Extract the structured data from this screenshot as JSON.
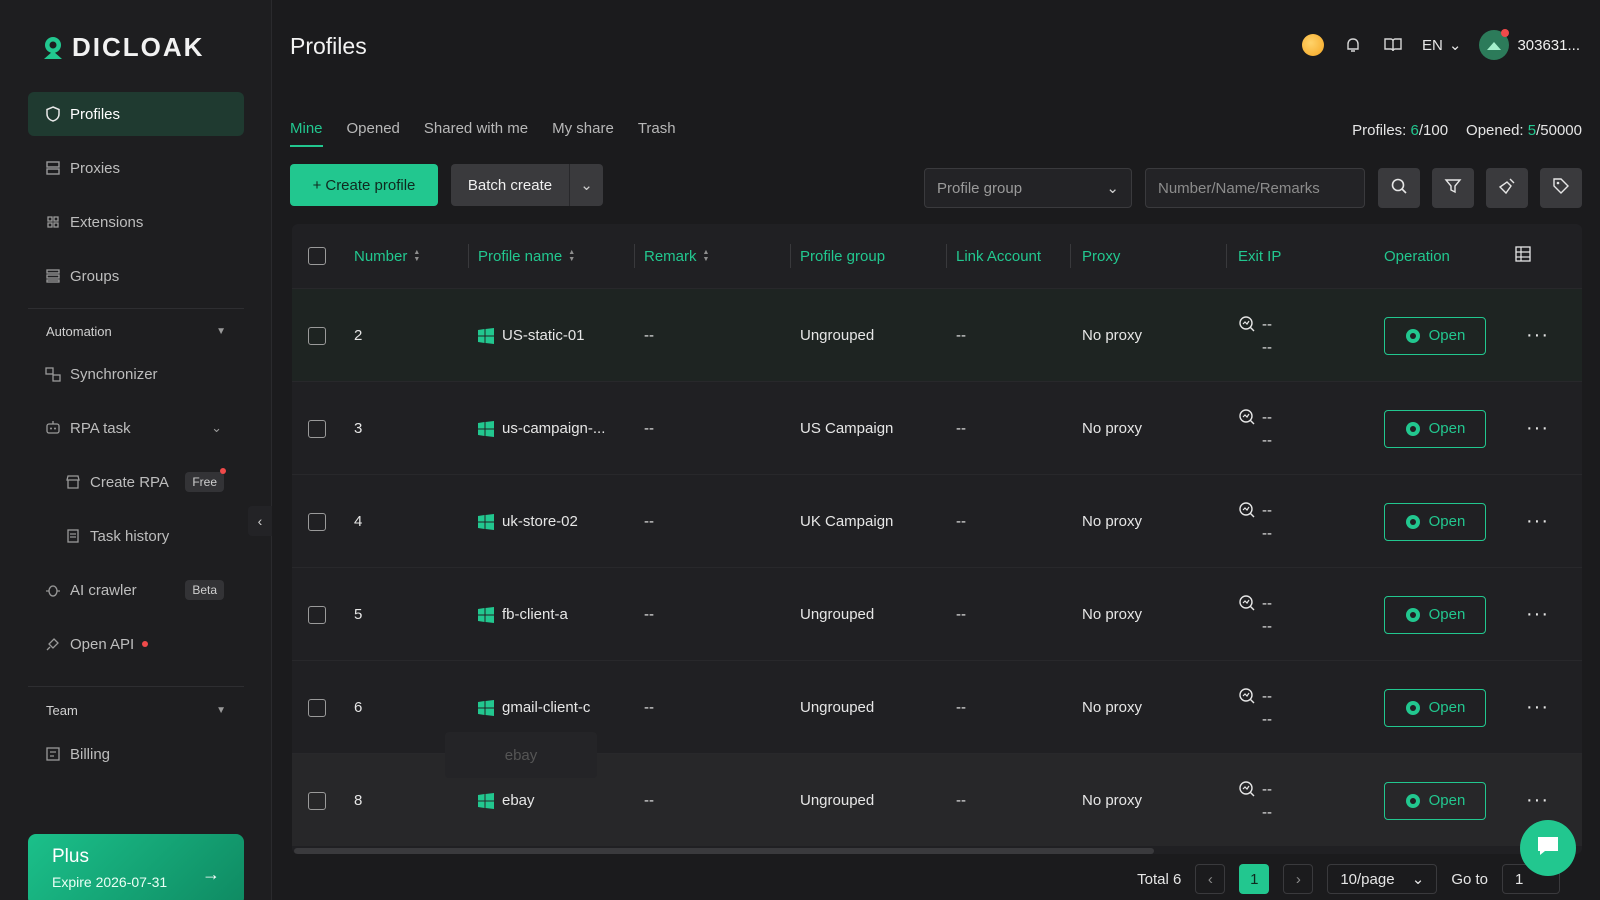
{
  "brand": {
    "name": "DICLOAK"
  },
  "sidebar": {
    "items": [
      {
        "label": "Profiles",
        "icon": "shield-icon"
      },
      {
        "label": "Proxies",
        "icon": "server-icon"
      },
      {
        "label": "Extensions",
        "icon": "extensions-icon"
      },
      {
        "label": "Groups",
        "icon": "groups-icon"
      }
    ],
    "automation": {
      "heading": "Automation",
      "synchronizer": "Synchronizer",
      "rpa_task": "RPA task",
      "create_rpa": "Create RPA",
      "create_rpa_tag": "Free",
      "task_history": "Task history",
      "ai_crawler": "AI crawler",
      "ai_crawler_tag": "Beta",
      "open_api": "Open API"
    },
    "team": {
      "heading": "Team",
      "billing": "Billing"
    },
    "plan": {
      "title": "Plus",
      "expire": "Expire 2026-07-31"
    }
  },
  "header": {
    "title": "Profiles",
    "language": "EN",
    "user": "303631..."
  },
  "tabs": [
    {
      "label": "Mine",
      "active": true
    },
    {
      "label": "Opened",
      "active": false
    },
    {
      "label": "Shared with me",
      "active": false
    },
    {
      "label": "My share",
      "active": false
    },
    {
      "label": "Trash",
      "active": false
    }
  ],
  "counts": {
    "profiles_label": "Profiles:",
    "profiles_value": "6",
    "profiles_max": "/100",
    "opened_label": "Opened:",
    "opened_value": "5",
    "opened_max": "/50000"
  },
  "toolbar": {
    "create_label": "Create profile",
    "batch_label": "Batch create",
    "group_placeholder": "Profile group",
    "search_placeholder": "Number/Name/Remarks"
  },
  "table": {
    "columns": [
      "Number",
      "Profile name",
      "Remark",
      "Profile group",
      "Link Account",
      "Proxy",
      "Exit IP",
      "Operation"
    ],
    "open_label": "Open",
    "rows": [
      {
        "number": "2",
        "name": "US-static-01",
        "remark": "--",
        "group": "Ungrouped",
        "link": "--",
        "proxy": "No proxy",
        "ip1": "--",
        "ip2": "--"
      },
      {
        "number": "3",
        "name": "us-campaign-...",
        "remark": "--",
        "group": "US Campaign",
        "link": "--",
        "proxy": "No proxy",
        "ip1": "--",
        "ip2": "--"
      },
      {
        "number": "4",
        "name": "uk-store-02",
        "remark": "--",
        "group": "UK Campaign",
        "link": "--",
        "proxy": "No proxy",
        "ip1": "--",
        "ip2": "--"
      },
      {
        "number": "5",
        "name": "fb-client-a",
        "remark": "--",
        "group": "Ungrouped",
        "link": "--",
        "proxy": "No proxy",
        "ip1": "--",
        "ip2": "--"
      },
      {
        "number": "6",
        "name": "gmail-client-c",
        "remark": "--",
        "group": "Ungrouped",
        "link": "--",
        "proxy": "No proxy",
        "ip1": "--",
        "ip2": "--"
      },
      {
        "number": "8",
        "name": "ebay",
        "remark": "--",
        "group": "Ungrouped",
        "link": "--",
        "proxy": "No proxy",
        "ip1": "--",
        "ip2": "--"
      }
    ],
    "tooltip": "ebay"
  },
  "pagination": {
    "total": "Total 6",
    "current": "1",
    "page_size": "10/page",
    "goto_label": "Go to",
    "goto_value": "1"
  },
  "colors": {
    "accent": "#22c78f",
    "background": "#1b1b1d"
  }
}
